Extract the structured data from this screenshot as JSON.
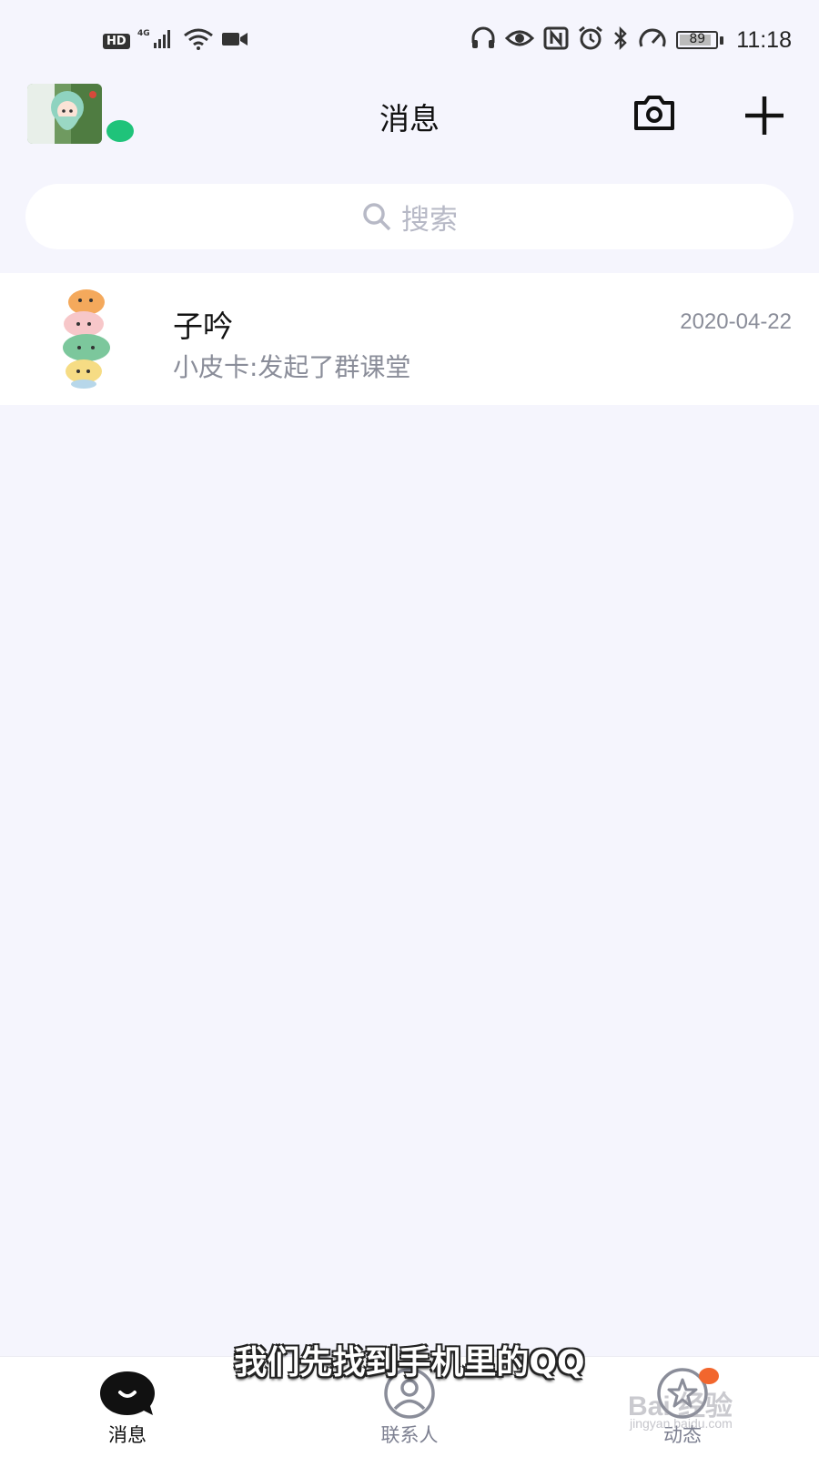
{
  "status_bar": {
    "hd": "HD",
    "network": "4G",
    "battery": "89",
    "time": "11:18"
  },
  "header": {
    "title": "消息",
    "online_color": "#1fc37a"
  },
  "search": {
    "placeholder": "搜索"
  },
  "conversations": [
    {
      "name": "子吟",
      "preview": "小皮卡:发起了群课堂",
      "time": "2020-04-22"
    }
  ],
  "subtitle": "我们先找到手机里的QQ",
  "tab_bar": {
    "tabs": [
      {
        "label": "消息",
        "active": true
      },
      {
        "label": "联系人",
        "active": false
      },
      {
        "label": "动态",
        "active": false,
        "badge_color": "#f2662d"
      }
    ]
  },
  "watermark": {
    "text": "Bai 经验",
    "url": "jingyan.baidu.com"
  }
}
